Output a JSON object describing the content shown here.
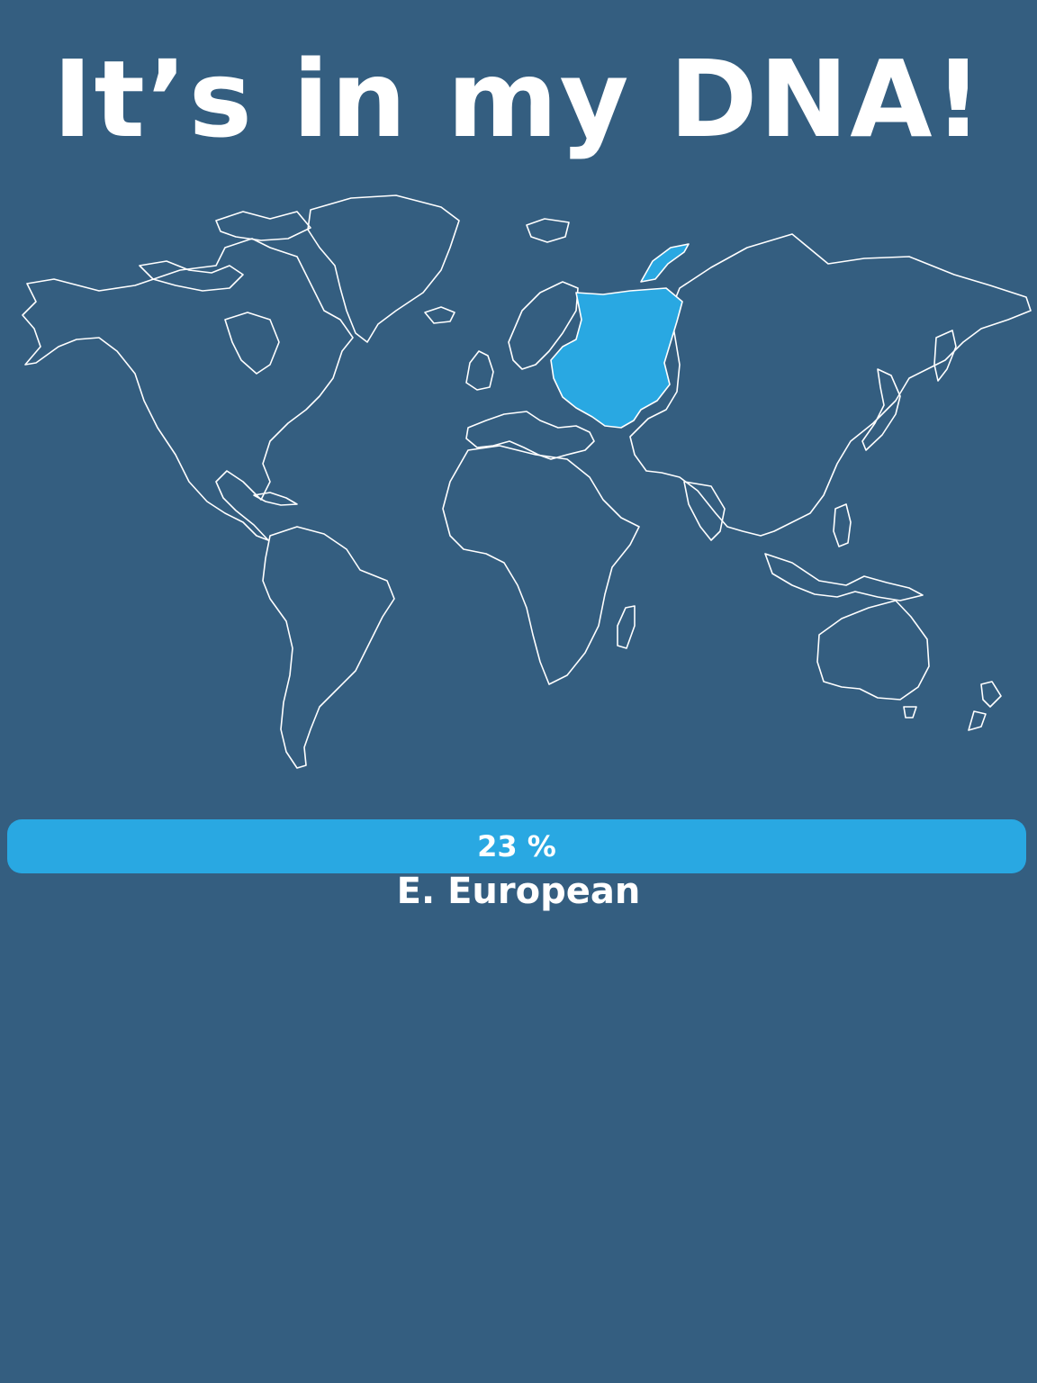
{
  "title": "It’s in my DNA!",
  "map": {
    "highlighted_region": "E. European",
    "outline_color": "#ffffff",
    "highlight_color": "#29a8e2"
  },
  "result": {
    "percent": 23,
    "percent_label": "23 %",
    "region_label": "E. European"
  },
  "colors": {
    "background": "#345e80",
    "accent": "#29a8e2",
    "text": "#ffffff"
  }
}
